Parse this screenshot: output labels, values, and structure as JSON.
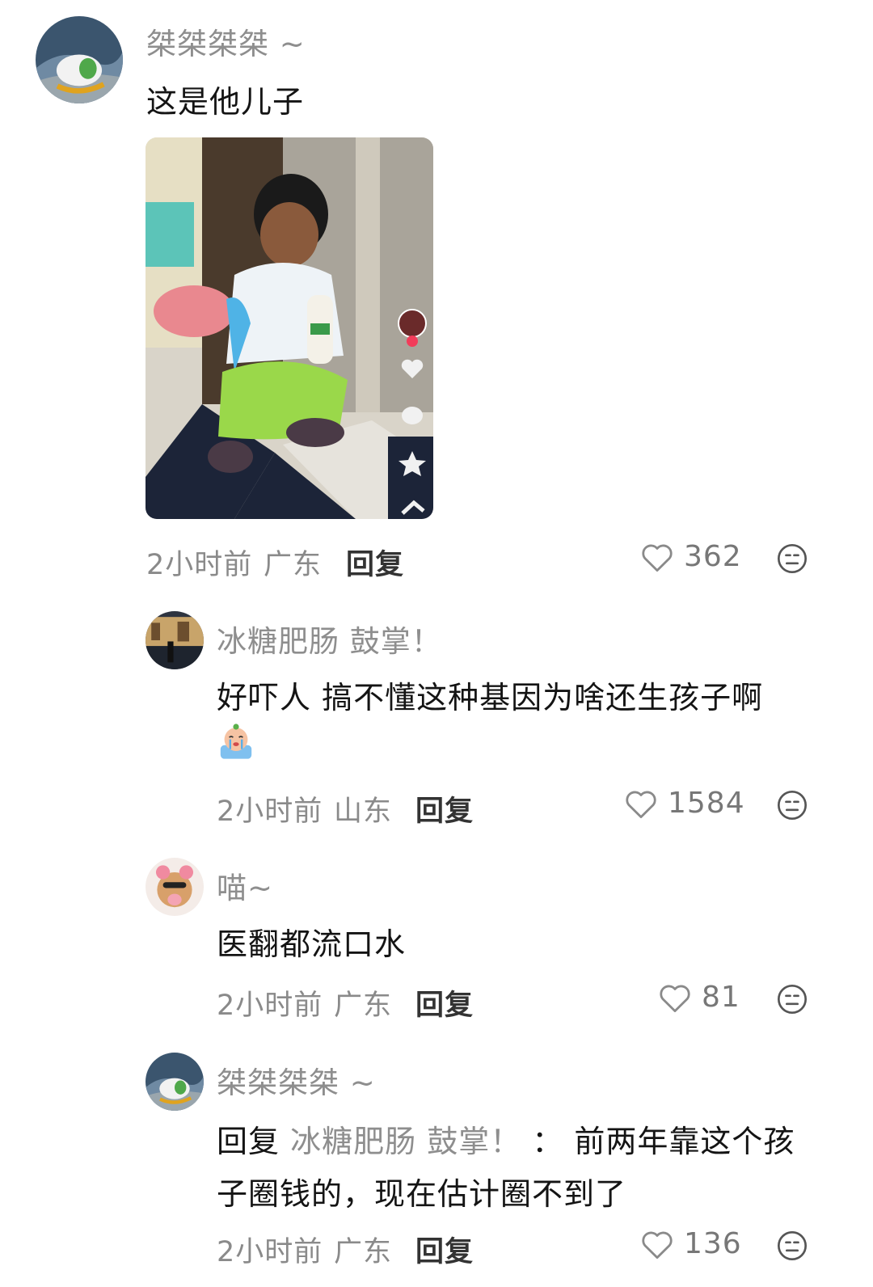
{
  "comments": [
    {
      "username": "桀桀桀桀 ~",
      "text": "这是他儿子",
      "time": "2小时前",
      "location": "广东",
      "reply_label": "回复",
      "likes": "362",
      "image_label": "photo of a toddler squatting on checkered floor holding a bottle"
    },
    {
      "username": "冰糖肥肠 鼓掌！",
      "text_line1": "好吓人 搞不懂这种基因为啥还生孩子啊",
      "emoji": "crying-emoji",
      "time": "2小时前",
      "location": "山东",
      "reply_label": "回复",
      "likes": "1584"
    },
    {
      "username": "喵~",
      "text": "医翻都流口水",
      "time": "2小时前",
      "location": "广东",
      "reply_label": "回复",
      "likes": "81"
    },
    {
      "username": "桀桀桀桀 ~",
      "reply_prefix": "回复",
      "reply_to": "冰糖肥肠 鼓掌！",
      "separator": "：",
      "text_line1_rest": "前两年靠这个孩",
      "text_line2": "子圈钱的，现在估计圈不到了",
      "time": "2小时前",
      "location": "广东",
      "reply_label": "回复",
      "likes": "136"
    }
  ],
  "icons": {
    "like": "heart-outline-icon",
    "more": "neutral-face-icon"
  },
  "colors": {
    "username": "#8e8e8e",
    "meta": "#8a8a8a",
    "text": "#141414"
  }
}
